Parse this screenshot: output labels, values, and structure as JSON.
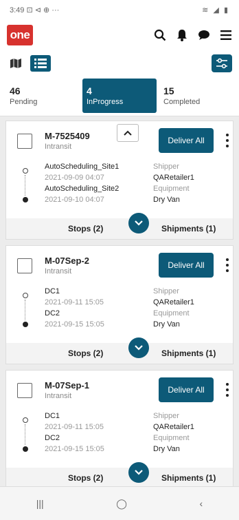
{
  "status_bar": {
    "time": "3:49",
    "left_icons": "⊡ ⊲ ⊕ ···",
    "right_icons": "≋ ◢ ▮"
  },
  "header": {
    "logo_text": "one",
    "icons": [
      "search-icon",
      "bell-icon",
      "chat-icon",
      "menu-icon"
    ]
  },
  "tabs": [
    {
      "count": "46",
      "label": "Pending"
    },
    {
      "count": "4",
      "label": "InProgress"
    },
    {
      "count": "15",
      "label": "Completed"
    }
  ],
  "cards": [
    {
      "id": "M-7525409",
      "status": "Intransit",
      "deliver_label": "Deliver All",
      "origin": "AutoScheduling_Site1",
      "origin_time": "2021-09-09 04:07",
      "dest": "AutoScheduling_Site2",
      "dest_time": "2021-09-10 04:07",
      "shipper_label": "Shipper",
      "shipper": "QARetailer1",
      "equipment_label": "Equipment",
      "equipment": "Dry Van",
      "stops": "Stops (2)",
      "shipments": "Shipments (1)"
    },
    {
      "id": "M-07Sep-2",
      "status": "Intransit",
      "deliver_label": "Deliver All",
      "origin": "DC1",
      "origin_time": "2021-09-11 15:05",
      "dest": "DC2",
      "dest_time": "2021-09-15 15:05",
      "shipper_label": "Shipper",
      "shipper": "QARetailer1",
      "equipment_label": "Equipment",
      "equipment": "Dry Van",
      "stops": "Stops (2)",
      "shipments": "Shipments (1)"
    },
    {
      "id": "M-07Sep-1",
      "status": "Intransit",
      "deliver_label": "Deliver All",
      "origin": "DC1",
      "origin_time": "2021-09-11 15:05",
      "dest": "DC2",
      "dest_time": "2021-09-15 15:05",
      "shipper_label": "Shipper",
      "shipper": "QARetailer1",
      "equipment_label": "Equipment",
      "equipment": "Dry Van",
      "stops": "Stops (2)",
      "shipments": "Shipments (1)"
    }
  ],
  "nav_bar": {
    "recent": "|||",
    "home": "◯",
    "back": "‹"
  },
  "colors": {
    "brand": "#d7322e",
    "accent": "#0d5a78"
  }
}
